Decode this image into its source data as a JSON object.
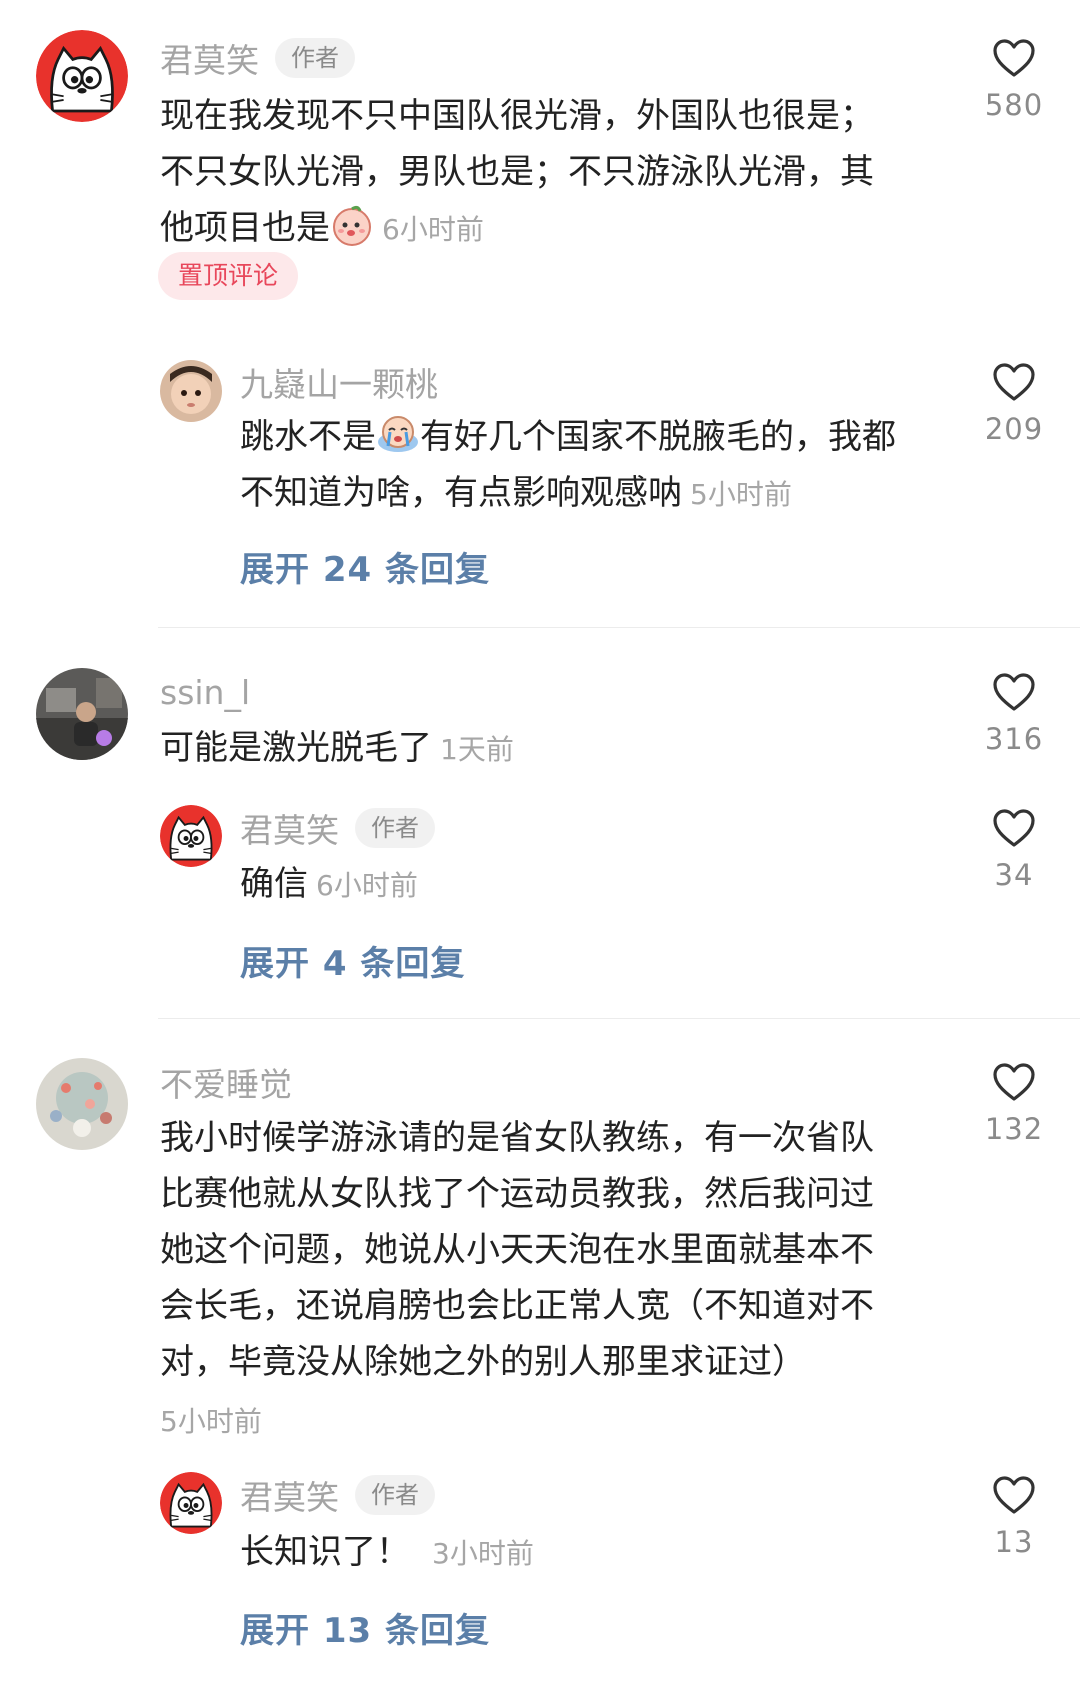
{
  "comments": [
    {
      "user": "君莫笑",
      "badge": "作者",
      "text_lines": [
        "现在我发现不只中国队很光滑，外国队也很是；",
        "不只女队光滑，男队也是；不只游泳队光滑，其",
        "他项目也是"
      ],
      "time": "6小时前",
      "pin_label": "置顶评论",
      "likes": "580",
      "reply": {
        "user": "九嶷山一颗桃",
        "text_lines": [
          "跳水不是",
          "有好几个国家不脱腋毛的，我都",
          "不知道为啥，有点影响观感呐"
        ],
        "time": "5小时前",
        "likes": "209"
      },
      "expand": "展开 24 条回复"
    },
    {
      "user": "ssin_l",
      "text": "可能是激光脱毛了",
      "time": "1天前",
      "likes": "316",
      "reply": {
        "user": "君莫笑",
        "badge": "作者",
        "text": "确信",
        "time": "6小时前",
        "likes": "34"
      },
      "expand": "展开 4 条回复"
    },
    {
      "user": "不爱睡觉",
      "text_lines": [
        "我小时候学游泳请的是省女队教练，有一次省队",
        "比赛他就从女队找了个运动员教我，然后我问过",
        "她这个问题，她说从小天天泡在水里面就基本不",
        "会长毛，还说肩膀也会比正常人宽（不知道对不",
        "对，毕竟没从除她之外的别人那里求证过）"
      ],
      "time": "5小时前",
      "likes": "132",
      "reply": {
        "user": "君莫笑",
        "badge": "作者",
        "text": "长知识了！",
        "time": "3小时前",
        "likes": "13"
      },
      "expand": "展开 13 条回复"
    }
  ],
  "icons": {
    "like": "heart-outline-icon",
    "author_avatar": "cartoon-cat-avatar",
    "emoji_1": "peach-blush-emoji",
    "emoji_2": "crying-emoji"
  },
  "colors": {
    "username": "#a4a4a4",
    "expand_link": "#5b7fa8",
    "pin_text": "#e8475b",
    "pin_bg": "#fde8ea",
    "author_badge_bg": "#f1f1f1"
  }
}
